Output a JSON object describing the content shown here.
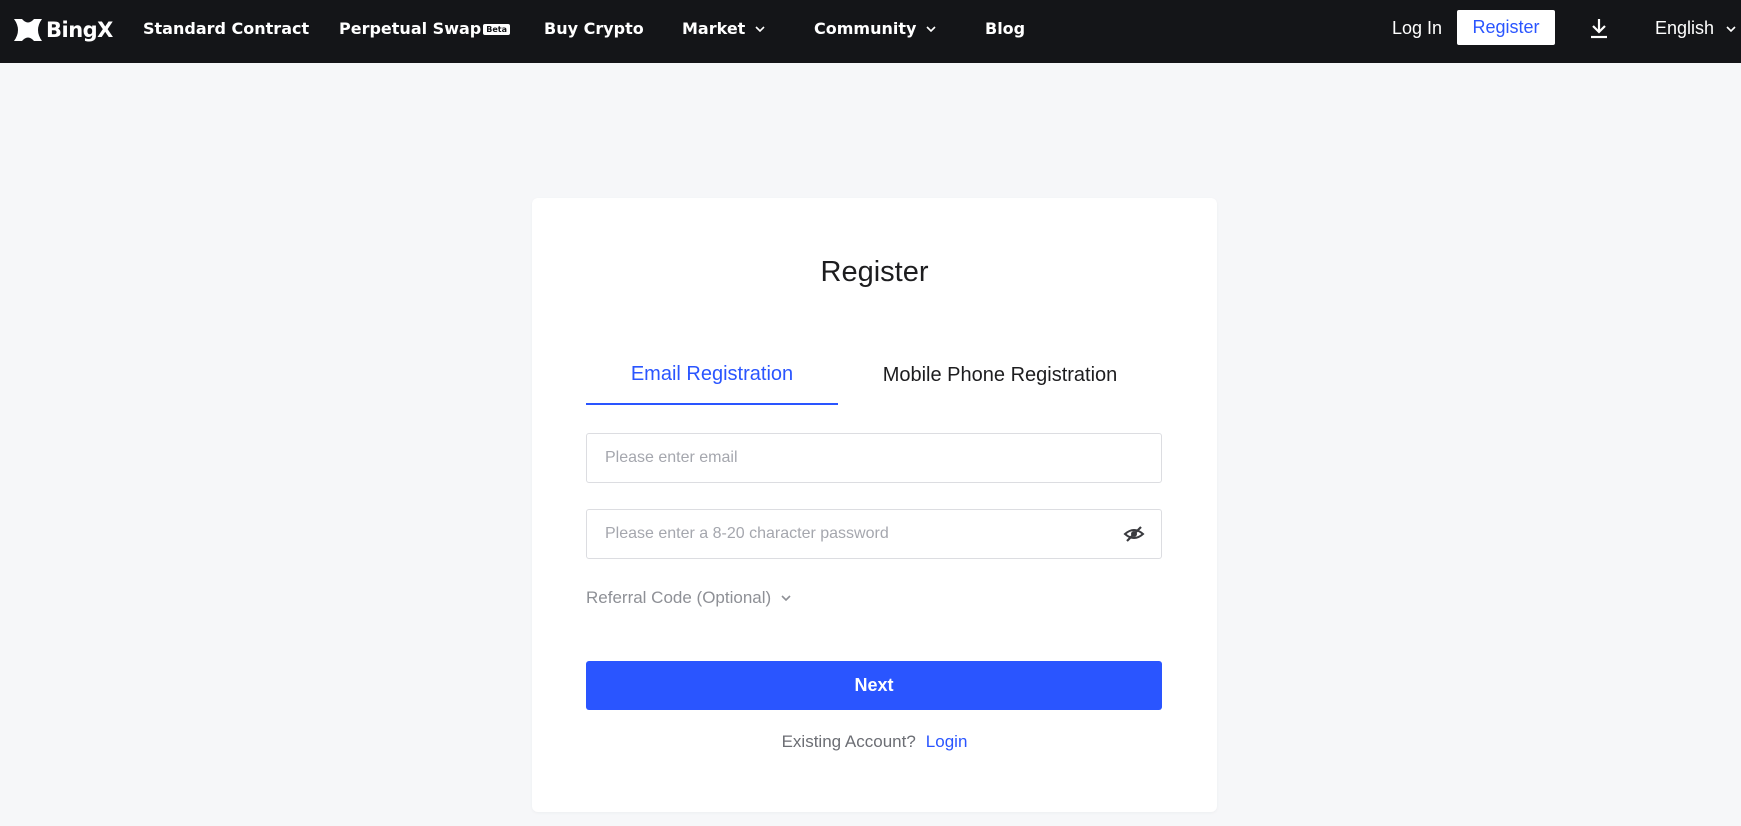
{
  "header": {
    "logo_text": "BingX",
    "nav": [
      {
        "label": "Standard Contract"
      },
      {
        "label": "Perpetual Swap",
        "badge": "Beta"
      },
      {
        "label": "Buy Crypto"
      },
      {
        "label": "Market",
        "icon": "chevron-down-icon"
      },
      {
        "label": "Community",
        "icon": "chevron-down-icon"
      },
      {
        "label": "Blog"
      }
    ],
    "login_label": "Log In",
    "register_label": "Register",
    "download_icon": "download-icon",
    "language": "English"
  },
  "register": {
    "title": "Register",
    "tabs": [
      {
        "label": "Email Registration",
        "active": true
      },
      {
        "label": "Mobile Phone Registration",
        "active": false
      }
    ],
    "email_placeholder": "Please enter email",
    "email_value": "",
    "password_placeholder": "Please enter a 8-20 character password",
    "password_value": "",
    "password_toggle_icon": "eye-off-icon",
    "referral_label": "Referral Code (Optional)",
    "next_label": "Next",
    "existing_text": "Existing Account?",
    "login_link": "Login"
  },
  "colors": {
    "accent": "#2a55ff",
    "header_bg": "#141518",
    "page_bg": "#f6f7f9",
    "text_primary": "#1d1d1f",
    "text_muted": "#8e9096"
  }
}
